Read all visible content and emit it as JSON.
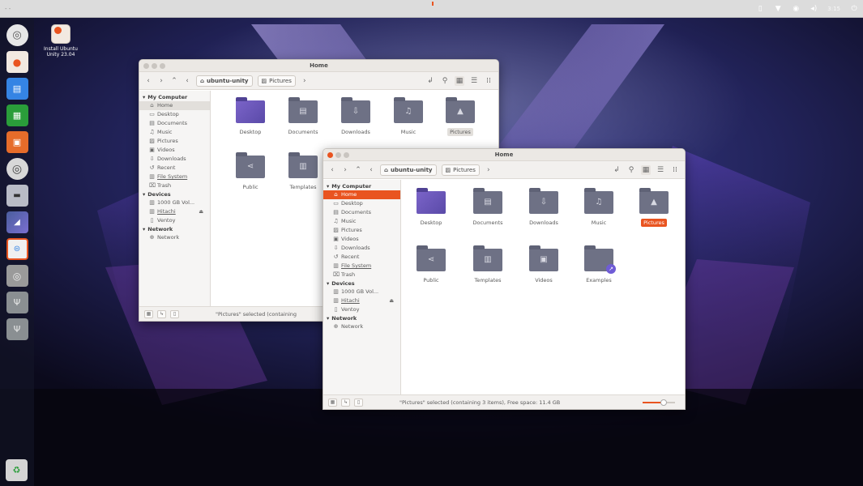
{
  "panel": {
    "title": "- -",
    "clock": "3:15"
  },
  "desktop": {
    "installer_label": "Install Ubuntu Unity 23.04"
  },
  "colors": {
    "accent": "#e95420",
    "folder": "#6e7185",
    "launcher_blue": "#3584e4"
  },
  "launcher": {
    "items": [
      {
        "name": "dash-icon"
      },
      {
        "name": "installer-icon"
      },
      {
        "name": "writer-icon"
      },
      {
        "name": "calc-icon"
      },
      {
        "name": "impress-icon"
      },
      {
        "name": "disk-icon"
      },
      {
        "name": "terminal-icon"
      },
      {
        "name": "files-icon"
      },
      {
        "name": "settings-icon"
      },
      {
        "name": "optical-icon"
      },
      {
        "name": "usb-icon-1"
      },
      {
        "name": "usb-icon-2"
      }
    ],
    "trash": "trash-icon"
  },
  "back_window": {
    "title": "Home",
    "crumb_home": "ubuntu-unity",
    "crumb_pictures": "Pictures",
    "sidebar_section_computer": "My Computer",
    "sidebar_computer": [
      "Home",
      "Desktop",
      "Documents",
      "Music",
      "Pictures",
      "Videos",
      "Downloads",
      "Recent",
      "File System",
      "Trash"
    ],
    "sidebar_section_devices": "Devices",
    "sidebar_devices": [
      "1000 GB Vol...",
      "Hitachi",
      "Ventoy"
    ],
    "sidebar_section_network": "Network",
    "sidebar_network": [
      "Network"
    ],
    "files": [
      "Desktop",
      "Documents",
      "Downloads",
      "Music",
      "Pictures",
      "Public",
      "Templates"
    ],
    "status": "\"Pictures\" selected (containing"
  },
  "front_window": {
    "title": "Home",
    "crumb_home": "ubuntu-unity",
    "crumb_pictures": "Pictures",
    "sidebar_section_computer": "My Computer",
    "sidebar_computer": [
      "Home",
      "Desktop",
      "Documents",
      "Music",
      "Pictures",
      "Videos",
      "Downloads",
      "Recent",
      "File System",
      "Trash"
    ],
    "sidebar_section_devices": "Devices",
    "sidebar_devices": [
      "1000 GB Vol...",
      "Hitachi",
      "Ventoy"
    ],
    "sidebar_section_network": "Network",
    "sidebar_network": [
      "Network"
    ],
    "files": [
      "Desktop",
      "Documents",
      "Downloads",
      "Music",
      "Pictures",
      "Public",
      "Templates",
      "Videos",
      "Examples"
    ],
    "selected_file": "Pictures",
    "status": "\"Pictures\" selected (containing 3 items), Free space: 11.4 GB",
    "zoom_level": 0.65
  }
}
